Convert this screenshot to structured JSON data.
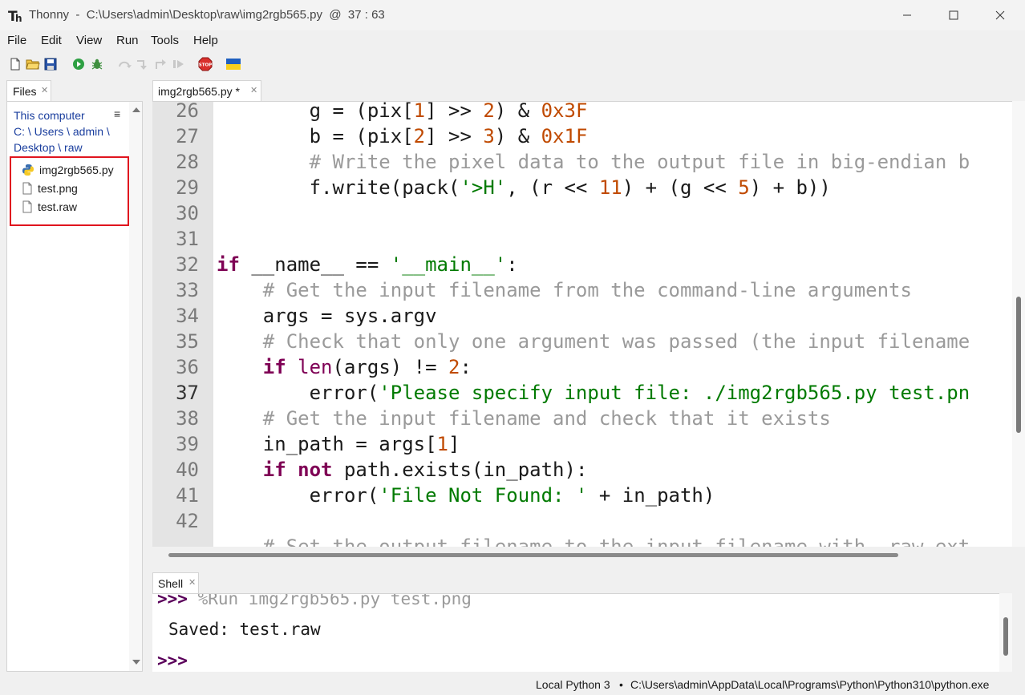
{
  "window": {
    "app_name": "Thonny",
    "title_rest": "  -  C:\\Users\\admin\\Desktop\\raw\\img2rgb565.py  @  37 : 63"
  },
  "menu": [
    "File",
    "Edit",
    "View",
    "Run",
    "Tools",
    "Help"
  ],
  "toolbar": {
    "icons": [
      "new-file-icon",
      "open-file-icon",
      "save-icon",
      "run-icon",
      "debug-icon",
      "step-over-icon",
      "step-into-icon",
      "step-out-icon",
      "resume-icon",
      "stop-icon",
      "ukraine-flag-icon"
    ]
  },
  "files": {
    "tab_label": "Files",
    "heading": "This computer",
    "crumb_lines": [
      "C: \\ Users \\ admin \\",
      "Desktop \\ raw"
    ],
    "items": [
      {
        "name": "img2rgb565.py",
        "icon": "python-file-icon"
      },
      {
        "name": "test.png",
        "icon": "file-icon"
      },
      {
        "name": "test.raw",
        "icon": "file-icon"
      }
    ]
  },
  "editor": {
    "tab_label": "img2rgb565.py *",
    "current_line": 37,
    "lines": [
      {
        "n": "26",
        "t": [
          [
            "",
            "        g = (pix["
          ],
          [
            "num",
            "1"
          ],
          [
            "",
            "] >> "
          ],
          [
            "num",
            "2"
          ],
          [
            "",
            ") & "
          ],
          [
            "num",
            "0x3F"
          ]
        ]
      },
      {
        "n": "27",
        "t": [
          [
            "",
            "        b = (pix["
          ],
          [
            "num",
            "2"
          ],
          [
            "",
            "] >> "
          ],
          [
            "num",
            "3"
          ],
          [
            "",
            ") & "
          ],
          [
            "num",
            "0x1F"
          ]
        ]
      },
      {
        "n": "28",
        "t": [
          [
            "",
            "        "
          ],
          [
            "cm",
            "# Write the pixel data to the output file in big-endian b"
          ]
        ]
      },
      {
        "n": "29",
        "t": [
          [
            "",
            "        f.write(pack("
          ],
          [
            "str",
            "'>H'"
          ],
          [
            "",
            ", (r << "
          ],
          [
            "num",
            "11"
          ],
          [
            "",
            ") + (g << "
          ],
          [
            "num",
            "5"
          ],
          [
            "",
            ") + b))"
          ]
        ]
      },
      {
        "n": "30",
        "t": []
      },
      {
        "n": "31",
        "t": []
      },
      {
        "n": "32",
        "t": [
          [
            "kw",
            "if"
          ],
          [
            "",
            " __name__ == "
          ],
          [
            "str",
            "'__main__'"
          ],
          [
            "",
            ":"
          ]
        ]
      },
      {
        "n": "33",
        "t": [
          [
            "",
            "    "
          ],
          [
            "cm",
            "# Get the input filename from the command-line arguments"
          ]
        ]
      },
      {
        "n": "34",
        "t": [
          [
            "",
            "    args = sys.argv"
          ]
        ]
      },
      {
        "n": "35",
        "t": [
          [
            "",
            "    "
          ],
          [
            "cm",
            "# Check that only one argument was passed (the input filename"
          ]
        ]
      },
      {
        "n": "36",
        "t": [
          [
            "",
            "    "
          ],
          [
            "kw",
            "if"
          ],
          [
            "",
            " "
          ],
          [
            "bi",
            "len"
          ],
          [
            "",
            "(args) != "
          ],
          [
            "num",
            "2"
          ],
          [
            "",
            ":"
          ]
        ]
      },
      {
        "n": "37",
        "t": [
          [
            "",
            "        error("
          ],
          [
            "str",
            "'Please specify input file: ./img2rgb565.py test.pn"
          ]
        ]
      },
      {
        "n": "38",
        "t": [
          [
            "",
            "    "
          ],
          [
            "cm",
            "# Get the input filename and check that it exists"
          ]
        ]
      },
      {
        "n": "39",
        "t": [
          [
            "",
            "    in_path = args["
          ],
          [
            "num",
            "1"
          ],
          [
            "",
            "]"
          ]
        ]
      },
      {
        "n": "40",
        "t": [
          [
            "",
            "    "
          ],
          [
            "kw",
            "if"
          ],
          [
            "",
            " "
          ],
          [
            "kw",
            "not"
          ],
          [
            "",
            " path.exists(in_path):"
          ]
        ]
      },
      {
        "n": "41",
        "t": [
          [
            "",
            "        error("
          ],
          [
            "str",
            "'File Not Found: '"
          ],
          [
            "",
            " + in_path)"
          ]
        ]
      },
      {
        "n": "42",
        "t": []
      },
      {
        "n": "",
        "t": [
          [
            "",
            "    "
          ],
          [
            "cm",
            "# Set the output filename to the input filename with .raw ext"
          ]
        ]
      }
    ]
  },
  "shell": {
    "tab_label": "Shell",
    "prompt": ">>>",
    "last_command": " %Run img2rgb565.py test.png",
    "output": "Saved: test.raw"
  },
  "status": {
    "interpreter": "Local Python 3",
    "separator": "•",
    "path": "C:\\Users\\admin\\AppData\\Local\\Programs\\Python\\Python310\\python.exe"
  }
}
